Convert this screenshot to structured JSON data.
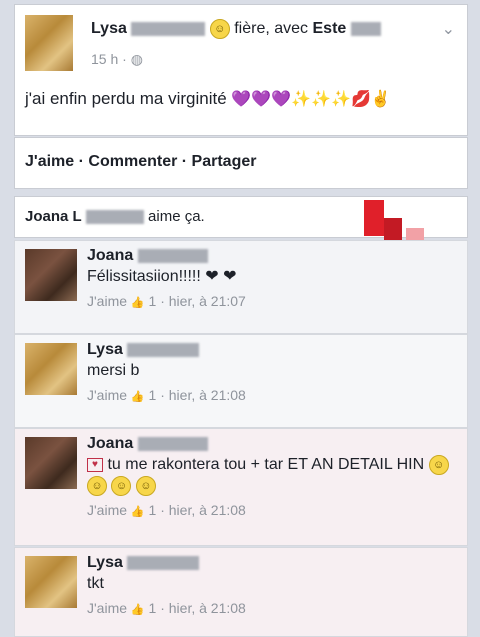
{
  "post": {
    "author": "Lysa",
    "feeling": "fière, avec",
    "tagged": "Este",
    "time": "15 h ·",
    "text": "j'ai enfin perdu ma virginité",
    "emojis": "💜💜💜✨✨✨💋✌"
  },
  "actions": {
    "like": "J'aime",
    "sep1": "·",
    "comment": "Commenter",
    "sep2": "·",
    "share": "Partager"
  },
  "likes": {
    "name": "Joana L",
    "text": "aime ça."
  },
  "comments": [
    {
      "author": "Joana",
      "text": "Félissitasiion!!!!! ❤ ❤",
      "like": "J'aime",
      "count": "1",
      "time": "· hier, à 21:07"
    },
    {
      "author": "Lysa",
      "text": "mersi b",
      "like": "J'aime",
      "count": "1",
      "time": "· hier, à 21:08"
    },
    {
      "author": "Joana",
      "text": "tu me rakontera tou + tar ET AN DETAIL HIN",
      "like": "J'aime",
      "count": "1",
      "time": "· hier, à 21:08"
    },
    {
      "author": "Lysa",
      "text": "tkt",
      "like": "J'aime",
      "count": "1",
      "time": "· hier, à 21:08"
    }
  ]
}
